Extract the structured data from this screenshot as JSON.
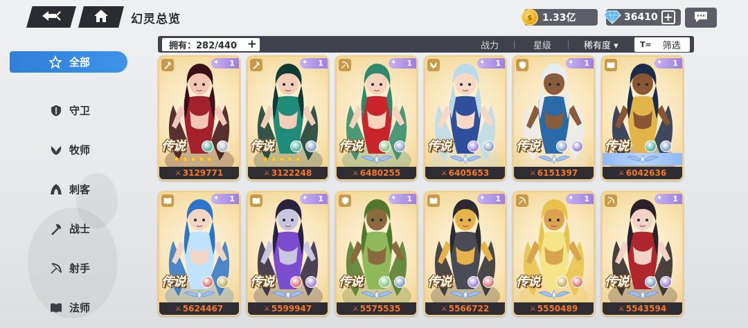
{
  "header": {
    "title": "幻灵总览",
    "gold": "1.33亿",
    "gems": "36410"
  },
  "sidebar": {
    "items": [
      {
        "label": "全部",
        "icon": "star-outline-icon",
        "active": true
      },
      {
        "label": "守卫",
        "icon": "shield-icon",
        "active": false
      },
      {
        "label": "牧师",
        "icon": "leaf-wing-icon",
        "active": false
      },
      {
        "label": "刺客",
        "icon": "hood-icon",
        "active": false
      },
      {
        "label": "战士",
        "icon": "axe-icon",
        "active": false
      },
      {
        "label": "射手",
        "icon": "bow-icon",
        "active": false
      },
      {
        "label": "法师",
        "icon": "book-icon",
        "active": false
      }
    ]
  },
  "filters": {
    "owned_label": "拥有：282/440",
    "tab_power": "战力",
    "tab_stars": "星级",
    "tab_rarity": "稀有度 ▾",
    "filter_label": "筛选",
    "filter_icon_text": "T="
  },
  "cards": [
    {
      "name": "demon-horned-girl",
      "class_icon": "axe-icon",
      "level": "1",
      "rarity": "传说",
      "stars": "★★★★★",
      "power": "3129771",
      "palette": [
        "#3a1016",
        "#a1222c",
        "#f2c7b5"
      ],
      "elements": [
        "#5fb6a8",
        "#b9bdc6"
      ]
    },
    {
      "name": "jade-dragon-girl",
      "class_icon": "axe-icon",
      "level": "1",
      "rarity": "传说",
      "stars": "★★★★★",
      "power": "3122248",
      "palette": [
        "#103a34",
        "#1f8b78",
        "#f2cdb8"
      ],
      "elements": [
        "#5fb6a8",
        "#8fa6c9"
      ]
    },
    {
      "name": "reindeer-girl",
      "class_icon": "bow-icon",
      "level": "1",
      "rarity": "传说",
      "stars": "",
      "power": "6480255",
      "palette": [
        "#2e8a6a",
        "#c9232c",
        "#f7d2bd"
      ],
      "elements": [
        "#8fc98a",
        "#8fa6c9"
      ]
    },
    {
      "name": "bunny-beach-girl",
      "class_icon": "leaf-wing-icon",
      "level": "1",
      "rarity": "传说",
      "stars": "",
      "power": "6405653",
      "palette": [
        "#b9dcec",
        "#2d4f9c",
        "#f7d8c6"
      ],
      "elements": [
        "#a78bd8",
        "#8fa6c9"
      ]
    },
    {
      "name": "wolf-hood-warrior",
      "class_icon": "shield-icon",
      "level": "1",
      "rarity": "传说",
      "stars": "",
      "power": "6151397",
      "palette": [
        "#e9ecef",
        "#2a6aa8",
        "#8a5b3c"
      ],
      "elements": [
        "#8fa6c9",
        "#a78bd8"
      ]
    },
    {
      "name": "pharaoh-priestess",
      "class_icon": "book-icon",
      "level": "1",
      "rarity": "传说",
      "stars": "",
      "power": "6042636",
      "palette": [
        "#1b2b4a",
        "#e2b54a",
        "#8a5533"
      ],
      "elements": [
        "#5fb6a8",
        "#8fa6c9"
      ],
      "blue_plate": true
    },
    {
      "name": "ocean-mage-girl",
      "class_icon": "book-icon",
      "level": "1",
      "rarity": "传说",
      "stars": "",
      "power": "5624467",
      "palette": [
        "#2d74c9",
        "#bfe3ff",
        "#f2d6c5"
      ],
      "elements": [
        "#e37a7a",
        "#c9b46a"
      ]
    },
    {
      "name": "dark-elf-sorceress",
      "class_icon": "book-icon",
      "level": "1",
      "rarity": "传说",
      "stars": "",
      "power": "5599947",
      "palette": [
        "#2a2340",
        "#7c4ccf",
        "#c9c6e0"
      ],
      "elements": [
        "#e37a7a",
        "#a78bd8"
      ]
    },
    {
      "name": "treant-golem",
      "class_icon": "shield-icon",
      "level": "1",
      "rarity": "传说",
      "stars": "",
      "power": "5575535",
      "palette": [
        "#4f7a2c",
        "#8eb85a",
        "#8a6a3e"
      ],
      "elements": [
        "#8fc98a",
        "#8fa6c9"
      ]
    },
    {
      "name": "black-beast",
      "class_icon": "book-icon",
      "level": "1",
      "rarity": "传说",
      "stars": "",
      "power": "5566722",
      "palette": [
        "#2a2a30",
        "#4b4b56",
        "#e6b24a"
      ],
      "elements": [
        "#a78bd8",
        "#e37a7a"
      ]
    },
    {
      "name": "golden-elf-archer",
      "class_icon": "bow-icon",
      "level": "1",
      "rarity": "传说",
      "stars": "",
      "power": "5550489",
      "palette": [
        "#e8c24a",
        "#f6e48a",
        "#d9a44e"
      ],
      "elements": [
        "#c9b46a",
        "#e37a7a"
      ]
    },
    {
      "name": "crimson-gunslinger",
      "class_icon": "bow-icon",
      "level": "1",
      "rarity": "传说",
      "stars": "",
      "power": "5543594",
      "palette": [
        "#2a2226",
        "#b0262f",
        "#f2d3c5"
      ],
      "elements": [
        "#8fa6c9",
        "#a78bd8"
      ]
    }
  ]
}
